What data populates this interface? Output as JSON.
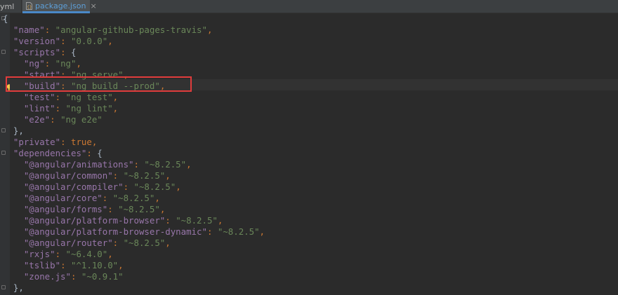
{
  "tabs": [
    {
      "label": "yml",
      "active": false
    },
    {
      "label": "package.json",
      "active": true,
      "icon": "json-file-icon"
    }
  ],
  "close_glyph": "×",
  "colors": {
    "background": "#2b2b2b",
    "key": "#9876aa",
    "string": "#6a8759",
    "punctuation": "#cc7832",
    "highlight_box": "#e03c3c",
    "active_tab_text": "#5d9fd8"
  },
  "code": {
    "open_brace": "{",
    "name": {
      "key": "\"name\"",
      "value": "\"angular-github-pages-travis\""
    },
    "version": {
      "key": "\"version\"",
      "value": "\"0.0.0\""
    },
    "scripts_key": "\"scripts\"",
    "scripts": [
      {
        "key": "\"ng\"",
        "value": "\"ng\""
      },
      {
        "key": "\"start\"",
        "value": "\"ng serve\""
      },
      {
        "key": "\"build\"",
        "value": "\"ng build --prod\""
      },
      {
        "key": "\"test\"",
        "value": "\"ng test\""
      },
      {
        "key": "\"lint\"",
        "value": "\"ng lint\""
      },
      {
        "key": "\"e2e\"",
        "value": "\"ng e2e\""
      }
    ],
    "scripts_close": "},",
    "private": {
      "key": "\"private\"",
      "value": "true"
    },
    "dependencies_key": "\"dependencies\"",
    "dependencies": [
      {
        "key": "\"@angular/animations\"",
        "value": "\"~8.2.5\""
      },
      {
        "key": "\"@angular/common\"",
        "value": "\"~8.2.5\""
      },
      {
        "key": "\"@angular/compiler\"",
        "value": "\"~8.2.5\""
      },
      {
        "key": "\"@angular/core\"",
        "value": "\"~8.2.5\""
      },
      {
        "key": "\"@angular/forms\"",
        "value": "\"~8.2.5\""
      },
      {
        "key": "\"@angular/platform-browser\"",
        "value": "\"~8.2.5\""
      },
      {
        "key": "\"@angular/platform-browser-dynamic\"",
        "value": "\"~8.2.5\""
      },
      {
        "key": "\"@angular/router\"",
        "value": "\"~8.2.5\""
      },
      {
        "key": "\"rxjs\"",
        "value": "\"~6.4.0\""
      },
      {
        "key": "\"tslib\"",
        "value": "\"^1.10.0\""
      },
      {
        "key": "\"zone.js\"",
        "value": "\"~0.9.1\""
      }
    ],
    "dependencies_close": "},"
  }
}
